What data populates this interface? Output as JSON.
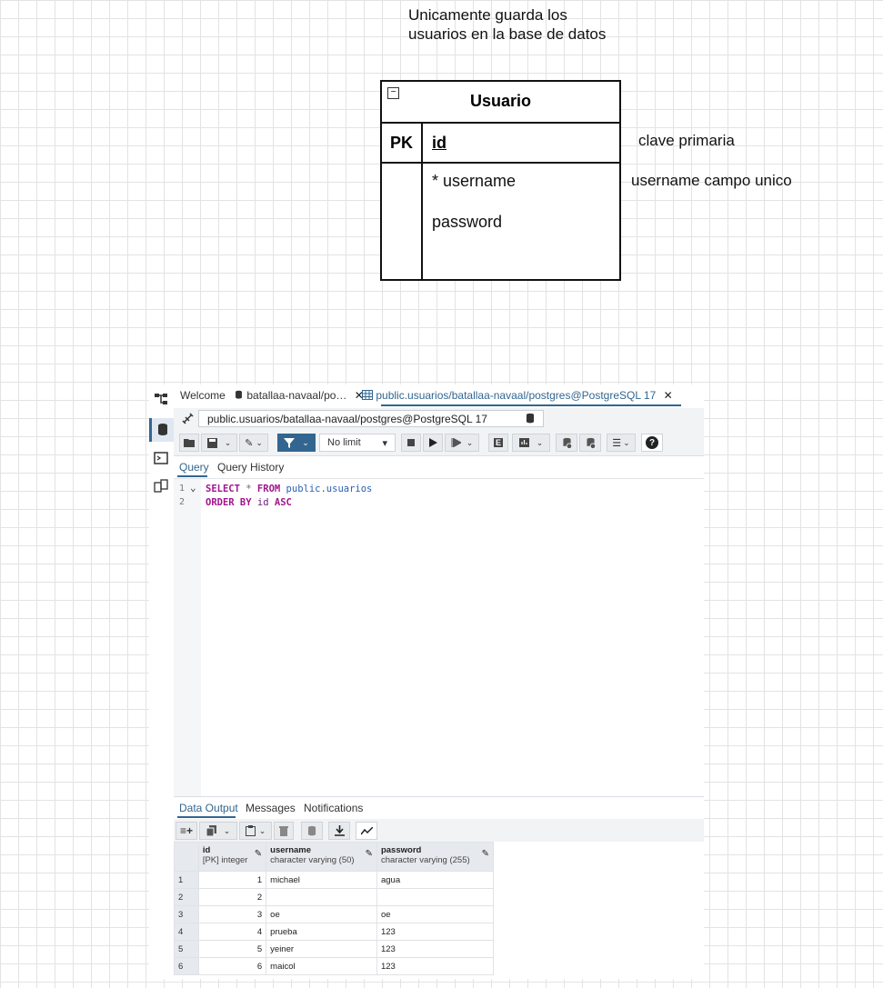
{
  "diagram": {
    "note_line1": "Unicamente guarda los",
    "note_line2": "usuarios en la base de datos",
    "entity_title": "Usuario",
    "collapse_glyph": "−",
    "pk_label": "PK",
    "pk_field": "id",
    "field_username": "* username",
    "field_password": "password",
    "annotation_pk": "clave primaria",
    "annotation_username": "username campo unico"
  },
  "app": {
    "tabs": [
      {
        "label": "Welcome"
      },
      {
        "label": "batallaa-navaal/po…",
        "close": "✕"
      },
      {
        "label": "public.usuarios/batallaa-navaal/postgres@PostgreSQL 17",
        "close": "✕"
      }
    ],
    "connection": "public.usuarios/batallaa-navaal/postgres@PostgreSQL 17",
    "toolbar": {
      "limit": "No limit",
      "limit_arrow": "▾",
      "help": "?"
    },
    "query_tabs": [
      "Query",
      "Query History"
    ],
    "editor": {
      "line_numbers": [
        "1",
        "2"
      ],
      "fold_glyph": "⌄"
    },
    "output_tabs": [
      "Data Output",
      "Messages",
      "Notifications"
    ],
    "grid": {
      "columns": [
        {
          "name": "id",
          "type": "[PK] integer"
        },
        {
          "name": "username",
          "type": "character varying (50)"
        },
        {
          "name": "password",
          "type": "character varying (255)"
        }
      ],
      "rows": [
        {
          "n": "1",
          "id": "1",
          "username": "michael",
          "password": "agua"
        },
        {
          "n": "2",
          "id": "2",
          "username": "",
          "password": ""
        },
        {
          "n": "3",
          "id": "3",
          "username": "oe",
          "password": "oe"
        },
        {
          "n": "4",
          "id": "4",
          "username": "prueba",
          "password": "123"
        },
        {
          "n": "5",
          "id": "5",
          "username": "yeiner",
          "password": "123"
        },
        {
          "n": "6",
          "id": "6",
          "username": "maicol",
          "password": "123"
        }
      ]
    }
  },
  "colors": {
    "accent": "#326690",
    "keyword": "#a0168c",
    "table_ref": "#2a5fb0"
  }
}
